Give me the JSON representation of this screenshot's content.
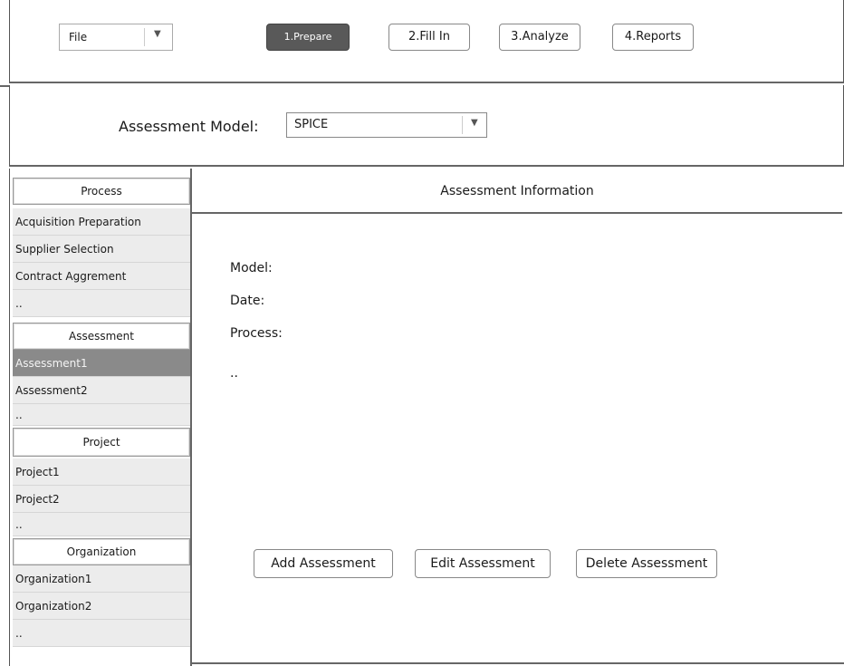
{
  "toolbar": {
    "file_value": "File",
    "steps": [
      "1.Prepare",
      "2.Fill In",
      "3.Analyze",
      "4.Reports"
    ],
    "active_step": "1.Prepare"
  },
  "model": {
    "label": "Assessment Model:",
    "value": "SPICE"
  },
  "sidebar": {
    "process": {
      "header": "Process",
      "items": [
        "Acquisition Preparation",
        "Supplier Selection",
        "Contract Aggrement",
        ".."
      ]
    },
    "assessment": {
      "header": "Assessment",
      "items": [
        "Assessment1",
        "Assessment2",
        ".."
      ],
      "selected": "Assessment1"
    },
    "project": {
      "header": "Project",
      "items": [
        "Project1",
        "Project2",
        ".."
      ]
    },
    "organization": {
      "header": "Organization",
      "items": [
        "Organization1",
        "Organization2",
        ".."
      ]
    }
  },
  "main": {
    "title": "Assessment Information",
    "fields": [
      "Model:",
      "Date:",
      "Process:",
      ".."
    ],
    "buttons": {
      "add": "Add Assessment",
      "edit": "Edit Assessment",
      "delete": "Delete Assessment"
    }
  },
  "icons": {
    "dropdown": "chevron-down-icon"
  }
}
